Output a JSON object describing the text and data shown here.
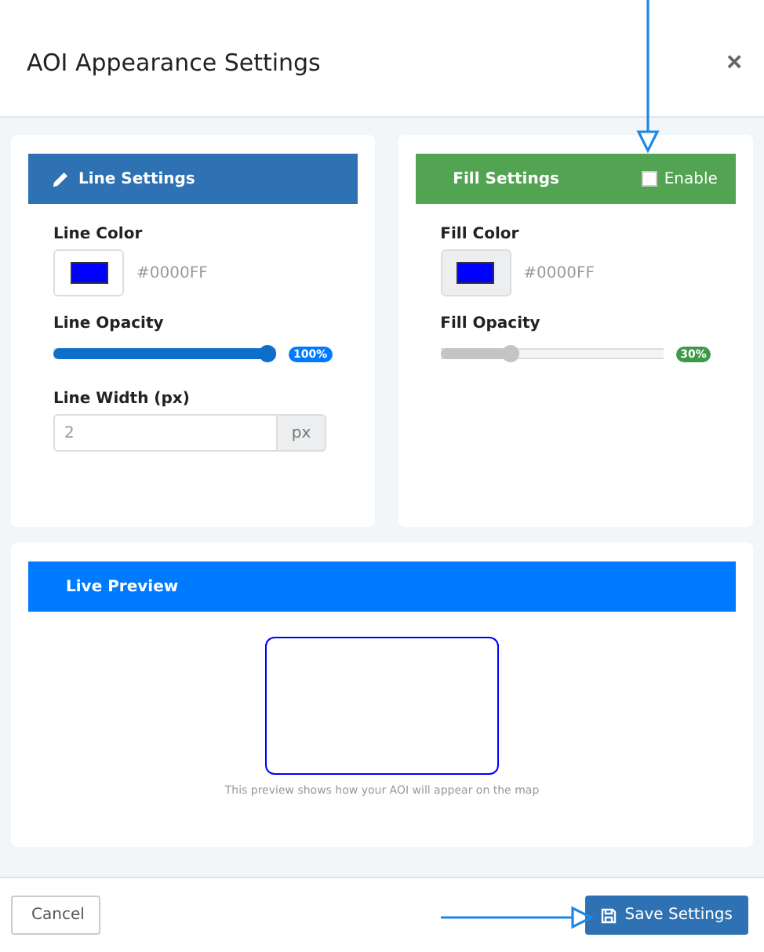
{
  "window": {
    "title": "AOI Appearance Settings",
    "close": "×"
  },
  "line_settings": {
    "title": "Line Settings",
    "color_label": "Line Color",
    "color": "#0000ff",
    "color_value": "#0000FF",
    "opacity_label": "Line Opacity",
    "opacity": {
      "level": 1.0,
      "reading": "100%"
    },
    "width_label": "Line Width (px)",
    "width_value": "2",
    "width_unit": "px"
  },
  "fill_settings": {
    "title": "Fill Settings",
    "enable": {
      "label": "Enable",
      "checked": false
    },
    "color_label": "Fill Color",
    "color": "#0000ff",
    "color_value": "#0000FF",
    "opacity_label": "Fill Opacity",
    "opacity": {
      "level": 0.3,
      "reading": "30%"
    }
  },
  "preview": {
    "title": "Live Preview",
    "caption": "This preview shows how your AOI will appear on the map"
  },
  "buttons": [
    {
      "kind": "secondary",
      "label": "Cancel"
    },
    {
      "kind": "primary",
      "label": "Save Settings"
    }
  ]
}
